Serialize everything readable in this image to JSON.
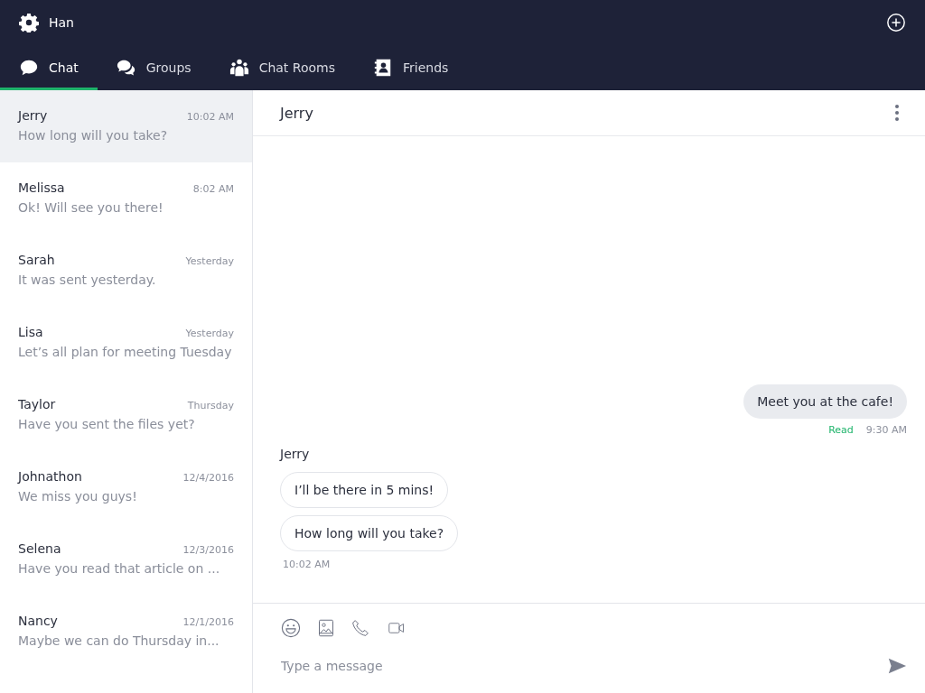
{
  "header": {
    "user": "Han"
  },
  "tabs": [
    {
      "label": "Chat",
      "selected": true
    },
    {
      "label": "Groups",
      "selected": false
    },
    {
      "label": "Chat Rooms",
      "selected": false
    },
    {
      "label": "Friends",
      "selected": false
    }
  ],
  "conversations": [
    {
      "name": "Jerry",
      "time": "10:02 AM",
      "preview": "How long will you take?",
      "selected": true
    },
    {
      "name": "Melissa",
      "time": "8:02 AM",
      "preview": "Ok! Will see you there!",
      "selected": false
    },
    {
      "name": "Sarah",
      "time": "Yesterday",
      "preview": "It was sent yesterday.",
      "selected": false
    },
    {
      "name": "Lisa",
      "time": "Yesterday",
      "preview": "Let’s all plan for meeting Tuesday",
      "selected": false
    },
    {
      "name": "Taylor",
      "time": "Thursday",
      "preview": "Have you sent the files yet?",
      "selected": false
    },
    {
      "name": "Johnathon",
      "time": "12/4/2016",
      "preview": "We miss you guys!",
      "selected": false
    },
    {
      "name": "Selena",
      "time": "12/3/2016",
      "preview": "Have you read that article on ...",
      "selected": false
    },
    {
      "name": "Nancy",
      "time": "12/1/2016",
      "preview": "Maybe we can do Thursday in...",
      "selected": false
    }
  ],
  "chat": {
    "title": "Jerry",
    "messages": [
      {
        "kind": "outgoing",
        "texts": [
          "Meet you at the cafe!"
        ],
        "status": "Read",
        "time": "9:30 AM"
      },
      {
        "kind": "incoming",
        "sender": "Jerry",
        "texts": [
          "I’ll be there in 5 mins!",
          "How long will you take?"
        ],
        "time": "10:02 AM"
      }
    ]
  },
  "composer": {
    "placeholder": "Type a message"
  }
}
